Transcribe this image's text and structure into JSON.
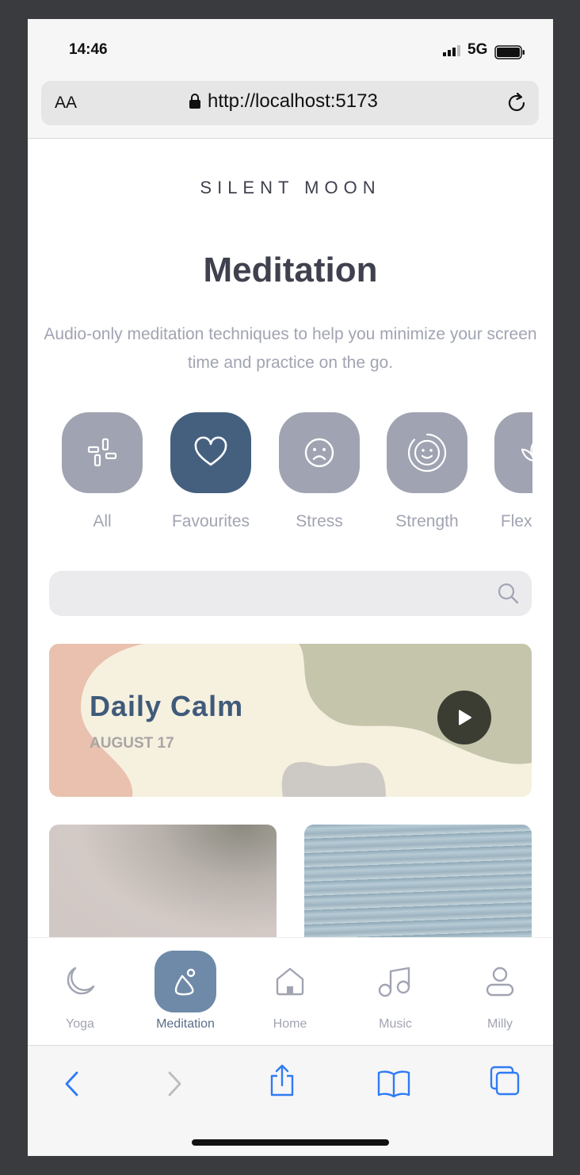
{
  "status_bar": {
    "time": "14:46",
    "network": "5G"
  },
  "browser": {
    "text_size_label": "AA",
    "url": "http://localhost:5173"
  },
  "brand": "SILENT  MOON",
  "page": {
    "title": "Meditation",
    "subtitle": "Audio-only meditation techniques to help you minimize your screen time and practice on the go."
  },
  "categories": [
    {
      "label": "All",
      "icon": "grid-icon",
      "active": false
    },
    {
      "label": "Favourites",
      "icon": "heart-icon",
      "active": true
    },
    {
      "label": "Stress",
      "icon": "sad-face-icon",
      "active": false
    },
    {
      "label": "Strength",
      "icon": "smile-ring-icon",
      "active": false
    },
    {
      "label": "Flexibility",
      "icon": "lotus-icon",
      "active": false
    }
  ],
  "search": {
    "placeholder": ""
  },
  "daily_calm": {
    "title": "Daily Calm",
    "date": "AUGUST 17"
  },
  "nav": [
    {
      "label": "Yoga",
      "icon": "moon-icon",
      "active": false
    },
    {
      "label": "Meditation",
      "icon": "meditation-icon",
      "active": true
    },
    {
      "label": "Home",
      "icon": "home-icon",
      "active": false
    },
    {
      "label": "Music",
      "icon": "music-icon",
      "active": false
    },
    {
      "label": "Milly",
      "icon": "user-icon",
      "active": false
    }
  ],
  "colors": {
    "accent": "#45607f",
    "nav_active": "#6f8aa8",
    "muted": "#a1a4b2",
    "heading": "#3f414e"
  }
}
